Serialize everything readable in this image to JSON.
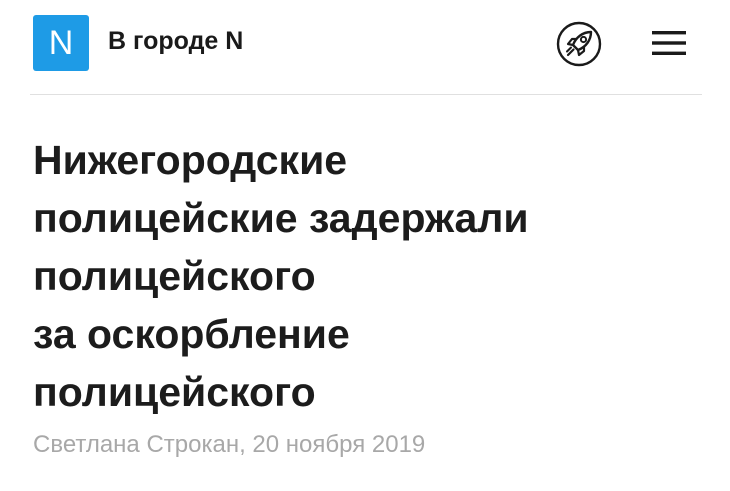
{
  "header": {
    "logo_letter": "N",
    "site_name": "В городе N",
    "rocket_icon": "rocket-icon",
    "menu_icon": "hamburger-menu-icon",
    "accent_color": "#1e9be6"
  },
  "article": {
    "headline_lines": [
      "Нижегородские",
      "полицейские задержали",
      "полицейского",
      "за оскорбление",
      "полицейского"
    ],
    "byline": "Светлана Строкан, 20 ноября 2019"
  }
}
